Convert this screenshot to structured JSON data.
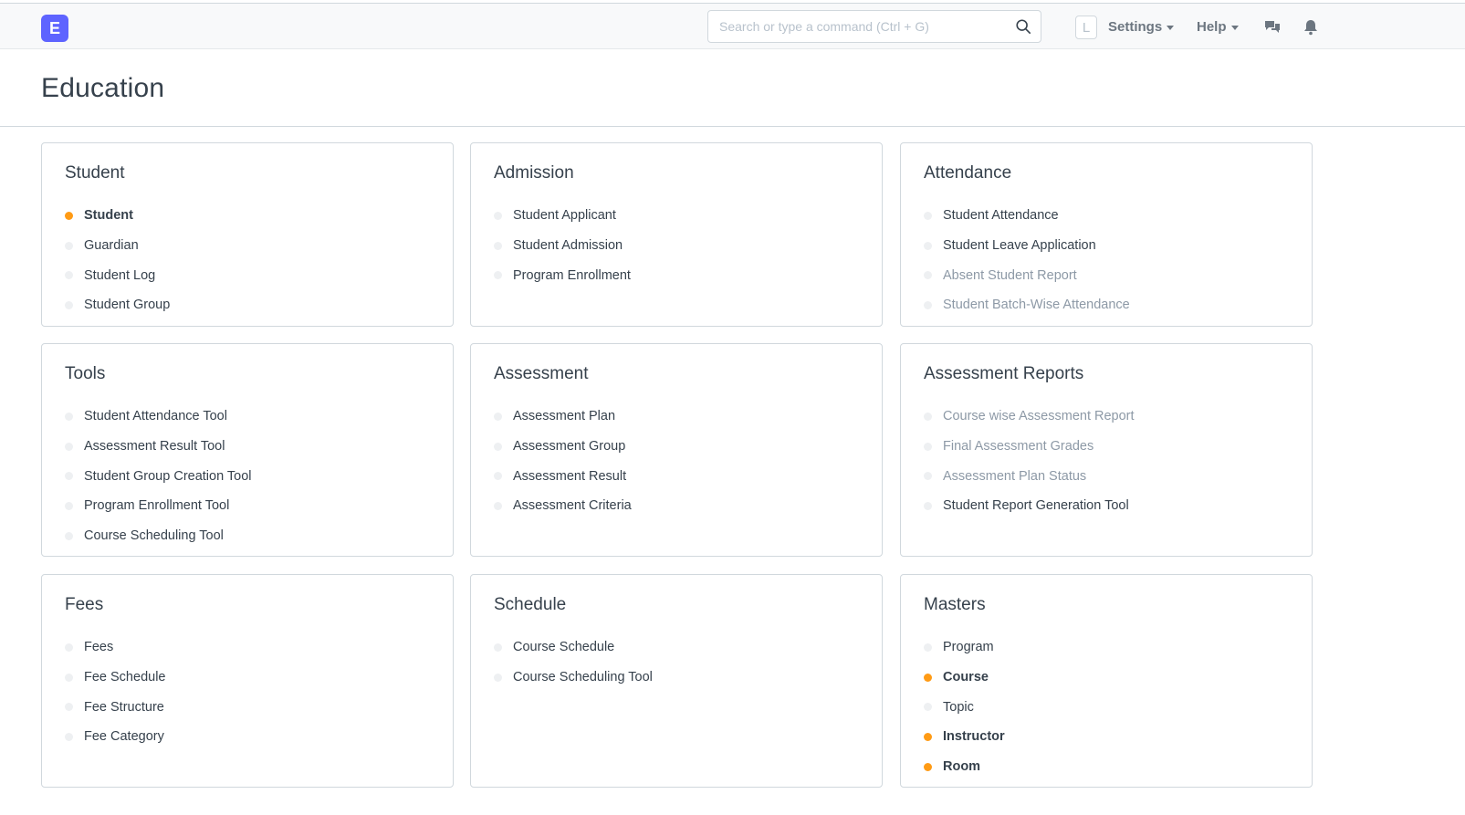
{
  "brand": {
    "letter": "E",
    "color": "#5e64ff"
  },
  "navbar": {
    "search_placeholder": "Search or type a command (Ctrl + G)",
    "search_value": "",
    "avatar_initial": "L",
    "settings_label": "Settings",
    "help_label": "Help",
    "icons": [
      "search-icon",
      "chat-icon",
      "bell-icon"
    ]
  },
  "page": {
    "title": "Education"
  },
  "colors": {
    "onboard_dot": "#ff9b15",
    "default_dot": "#eef0f2",
    "muted_text": "#8d99a6",
    "text": "#36414c"
  },
  "cards": [
    {
      "title": "Student",
      "items": [
        {
          "label": "Student",
          "state": "onboard"
        },
        {
          "label": "Guardian",
          "state": "normal"
        },
        {
          "label": "Student Log",
          "state": "normal"
        },
        {
          "label": "Student Group",
          "state": "normal"
        }
      ]
    },
    {
      "title": "Admission",
      "items": [
        {
          "label": "Student Applicant",
          "state": "normal"
        },
        {
          "label": "Student Admission",
          "state": "normal"
        },
        {
          "label": "Program Enrollment",
          "state": "normal"
        }
      ]
    },
    {
      "title": "Attendance",
      "items": [
        {
          "label": "Student Attendance",
          "state": "normal"
        },
        {
          "label": "Student Leave Application",
          "state": "normal"
        },
        {
          "label": "Absent Student Report",
          "state": "muted"
        },
        {
          "label": "Student Batch-Wise Attendance",
          "state": "muted"
        }
      ]
    },
    {
      "title": "Tools",
      "items": [
        {
          "label": "Student Attendance Tool",
          "state": "normal"
        },
        {
          "label": "Assessment Result Tool",
          "state": "normal"
        },
        {
          "label": "Student Group Creation Tool",
          "state": "normal"
        },
        {
          "label": "Program Enrollment Tool",
          "state": "normal"
        },
        {
          "label": "Course Scheduling Tool",
          "state": "normal"
        }
      ]
    },
    {
      "title": "Assessment",
      "items": [
        {
          "label": "Assessment Plan",
          "state": "normal"
        },
        {
          "label": "Assessment Group",
          "state": "normal"
        },
        {
          "label": "Assessment Result",
          "state": "normal"
        },
        {
          "label": "Assessment Criteria",
          "state": "normal"
        }
      ]
    },
    {
      "title": "Assessment Reports",
      "items": [
        {
          "label": "Course wise Assessment Report",
          "state": "muted"
        },
        {
          "label": "Final Assessment Grades",
          "state": "muted"
        },
        {
          "label": "Assessment Plan Status",
          "state": "muted"
        },
        {
          "label": "Student Report Generation Tool",
          "state": "normal"
        }
      ]
    },
    {
      "title": "Fees",
      "items": [
        {
          "label": "Fees",
          "state": "normal"
        },
        {
          "label": "Fee Schedule",
          "state": "normal"
        },
        {
          "label": "Fee Structure",
          "state": "normal"
        },
        {
          "label": "Fee Category",
          "state": "normal"
        }
      ]
    },
    {
      "title": "Schedule",
      "items": [
        {
          "label": "Course Schedule",
          "state": "normal"
        },
        {
          "label": "Course Scheduling Tool",
          "state": "normal"
        }
      ]
    },
    {
      "title": "Masters",
      "items": [
        {
          "label": "Program",
          "state": "normal"
        },
        {
          "label": "Course",
          "state": "onboard"
        },
        {
          "label": "Topic",
          "state": "normal"
        },
        {
          "label": "Instructor",
          "state": "onboard"
        },
        {
          "label": "Room",
          "state": "onboard"
        }
      ]
    }
  ]
}
